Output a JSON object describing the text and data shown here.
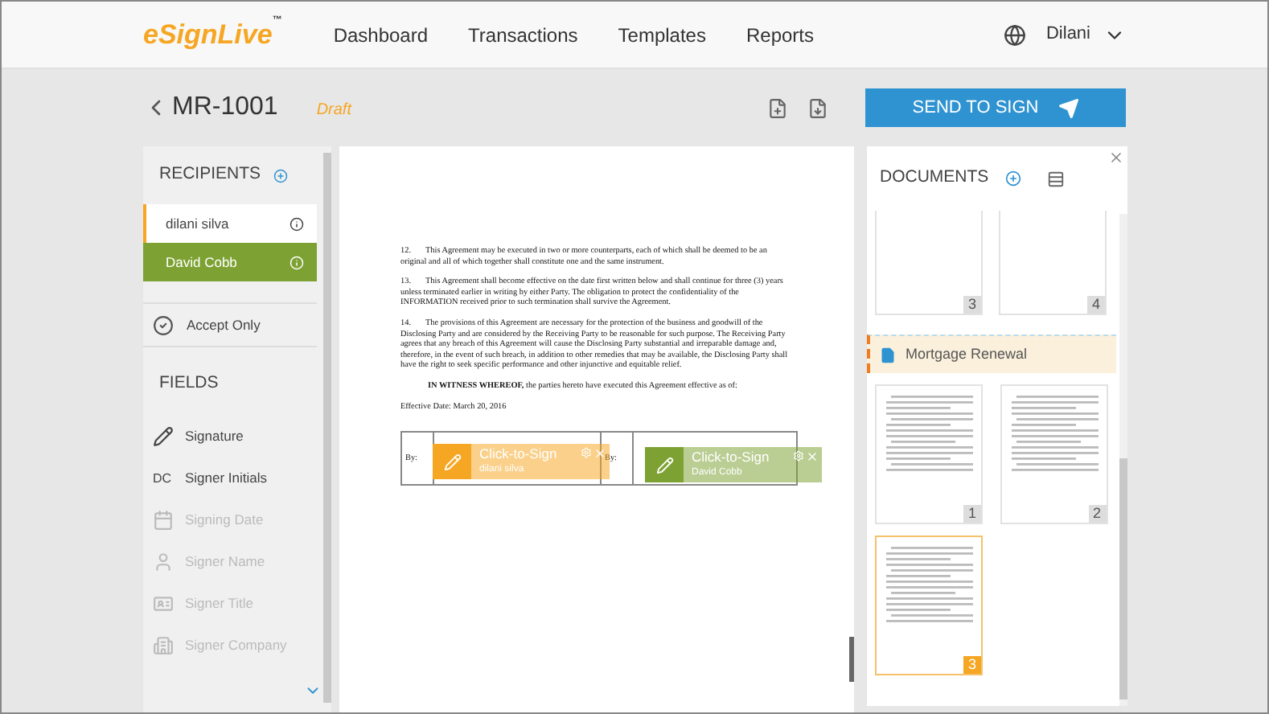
{
  "nav": {
    "logo": "eSignLive",
    "logo_mark": "™",
    "links": [
      "Dashboard",
      "Transactions",
      "Templates",
      "Reports"
    ],
    "user": "Dilani"
  },
  "transaction": {
    "name": "MR-1001",
    "status": "Draft",
    "send_button": "SEND TO SIGN"
  },
  "recipients": {
    "title": "RECIPIENTS",
    "items": [
      {
        "name": "dilani silva",
        "selected": false,
        "color": "#f5a623"
      },
      {
        "name": "David Cobb",
        "selected": true,
        "color": "#7da233"
      }
    ]
  },
  "accept_only": "Accept Only",
  "fields": {
    "title": "FIELDS",
    "items": [
      {
        "label": "Signature",
        "disabled": false
      },
      {
        "label": "Signer Initials",
        "badge": "DC",
        "disabled": false
      },
      {
        "label": "Signing Date",
        "disabled": true
      },
      {
        "label": "Signer Name",
        "disabled": true
      },
      {
        "label": "Signer Title",
        "disabled": true
      },
      {
        "label": "Signer Company",
        "disabled": true
      }
    ]
  },
  "document": {
    "paragraphs": [
      {
        "number": "12.",
        "text": "This Agreement may be executed in two or more counterparts, each of which shall be deemed to be an original and all of which together shall constitute one and the same instrument."
      },
      {
        "number": "13.",
        "text": "This Agreement shall become effective on the date first written below and shall continue for three (3) years unless terminated earlier in writing by either Party. The obligation to protect the confidentiality of the INFORMATION received prior to such termination shall survive the Agreement."
      },
      {
        "number": "14.",
        "text": "The provisions of this Agreement are necessary for the protection of the business and goodwill of the Disclosing Party and are considered by the Receiving Party to be reasonable for such purpose. The Receiving Party agrees that any breach of this Agreement will cause the Disclosing Party substantial and irreparable damage and, therefore, in the event of such breach, in addition to other remedies that may be available, the Disclosing Party shall have the right to seek specific performance and other injunctive and equitable relief."
      }
    ],
    "witness": "**IN WITNESS WHEREOF,** the parties hereto have executed this Agreement effective as of:",
    "effective_date": "Effective Date: March 20, 2016",
    "by_labels": [
      "By:",
      "By:"
    ],
    "signature_fields": [
      {
        "label": "Click-to-Sign",
        "signer": "dilani silva",
        "color": "#f5a623"
      },
      {
        "label": "Click-to-Sign",
        "signer": "David Cobb",
        "color": "#7da233"
      }
    ]
  },
  "documents_panel": {
    "title": "DOCUMENTS",
    "previous_pages": [
      {
        "number": "3",
        "selected": false
      },
      {
        "number": "4",
        "selected": false
      }
    ],
    "document_name": "Mortgage Renewal",
    "pages": [
      {
        "number": "1",
        "selected": false
      },
      {
        "number": "2",
        "selected": false
      },
      {
        "number": "3",
        "selected": true
      }
    ]
  }
}
